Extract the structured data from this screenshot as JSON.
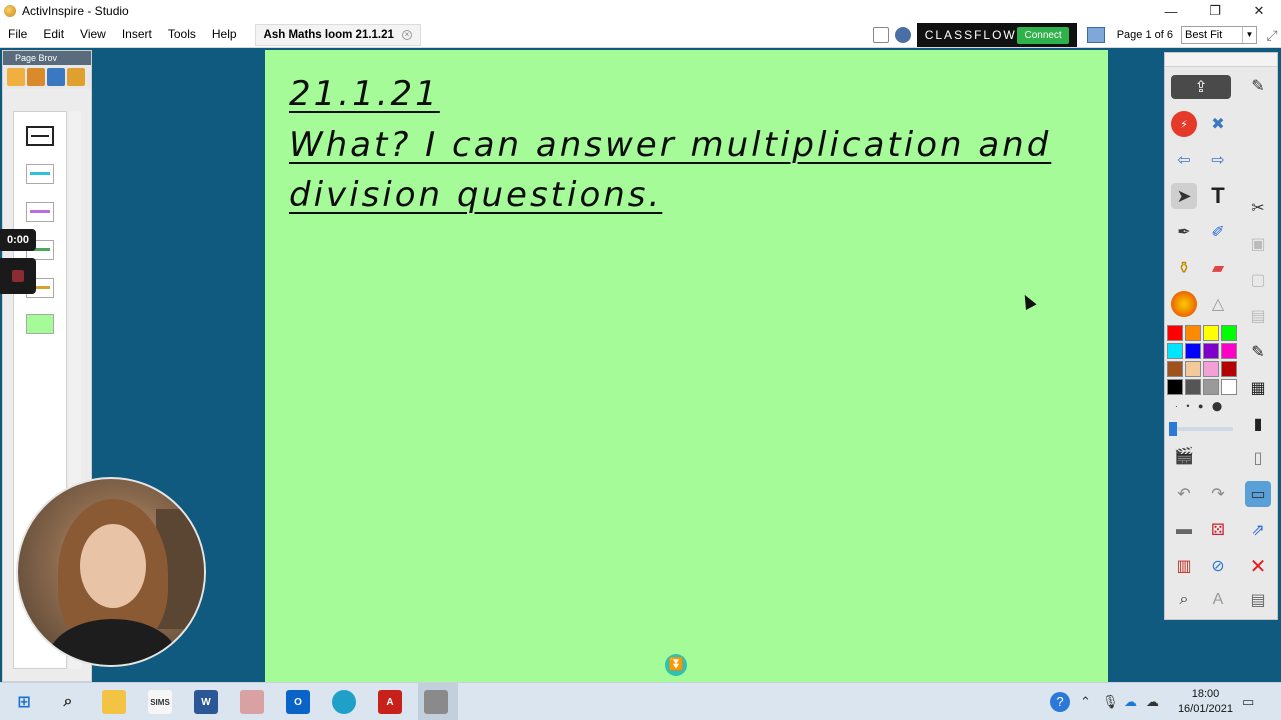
{
  "window": {
    "title": "ActivInspire - Studio",
    "controls": [
      "—",
      "❐",
      "✕"
    ]
  },
  "menu": {
    "items": [
      "File",
      "Edit",
      "View",
      "Insert",
      "Tools",
      "Help"
    ],
    "doc_tab": "Ash Maths loom 21.1.21",
    "doc_tab_close": "×",
    "classflow": "CLASSFLOW",
    "connect": "Connect",
    "page_indicator": "Page 1 of 6",
    "zoom": "Best Fit"
  },
  "page_browser": {
    "title": "Page Brov"
  },
  "recorder": {
    "time": "0:00"
  },
  "canvas": {
    "date": "21.1.21",
    "line1": "What? I can answer multiplication and",
    "line2": "division questions.",
    "page_down_glyph": "⏬"
  },
  "toolbox": {
    "swatches": [
      "#ff0000",
      "#ff8a00",
      "#ffff00",
      "#00ff00",
      "#00e5ff",
      "#0000ff",
      "#7f00c8",
      "#ff00c8",
      "#a0521e",
      "#f4c99a",
      "#f4a0d8",
      "#b40000",
      "#000000",
      "#555555",
      "#9a9a9a",
      "#ffffff"
    ]
  },
  "taskbar": {
    "time": "18:00",
    "date": "16/01/2021"
  }
}
